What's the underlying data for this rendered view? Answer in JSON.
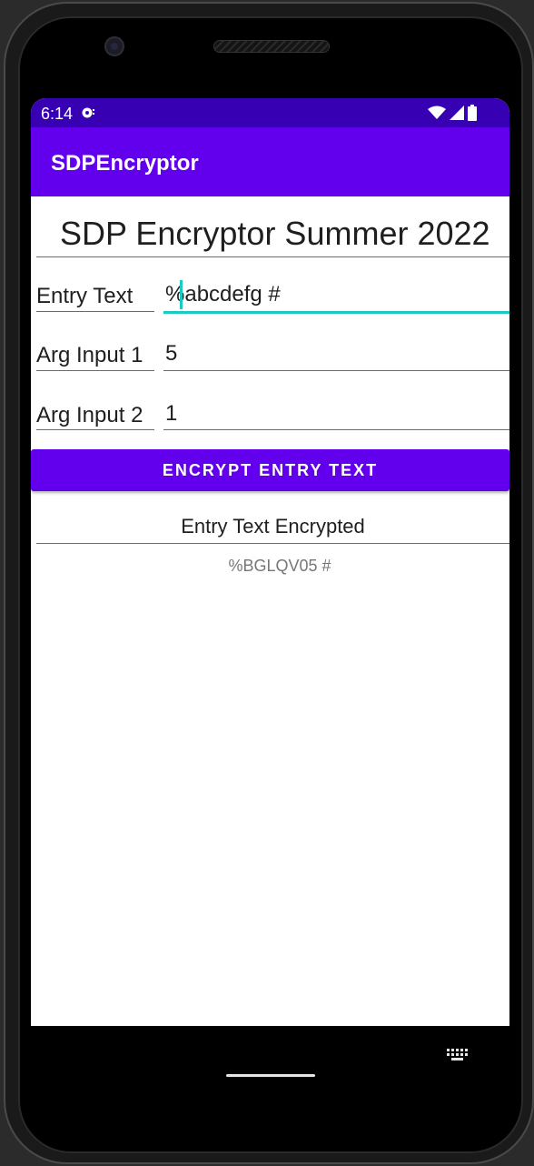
{
  "status_bar": {
    "time": "6:14",
    "icons": [
      "notification-icon",
      "wifi-icon",
      "signal-icon",
      "battery-icon"
    ]
  },
  "app_bar": {
    "title": "SDPEncryptor"
  },
  "main": {
    "heading": "SDP Encryptor Summer 2022",
    "fields": [
      {
        "label": "Entry Text",
        "value": "%abcdefg #"
      },
      {
        "label": "Arg Input 1",
        "value": "5"
      },
      {
        "label": "Arg Input 2",
        "value": "1"
      }
    ],
    "encrypt_button_label": "ENCRYPT ENTRY TEXT",
    "result_heading": "Entry Text Encrypted",
    "result_value": "%BGLQV05 #"
  },
  "colors": {
    "status_bar": "#3700b3",
    "primary": "#6200ee",
    "accent": "#1ec9c0"
  },
  "nav_bar": {
    "icons": [
      "home-pill",
      "keyboard-icon"
    ]
  }
}
